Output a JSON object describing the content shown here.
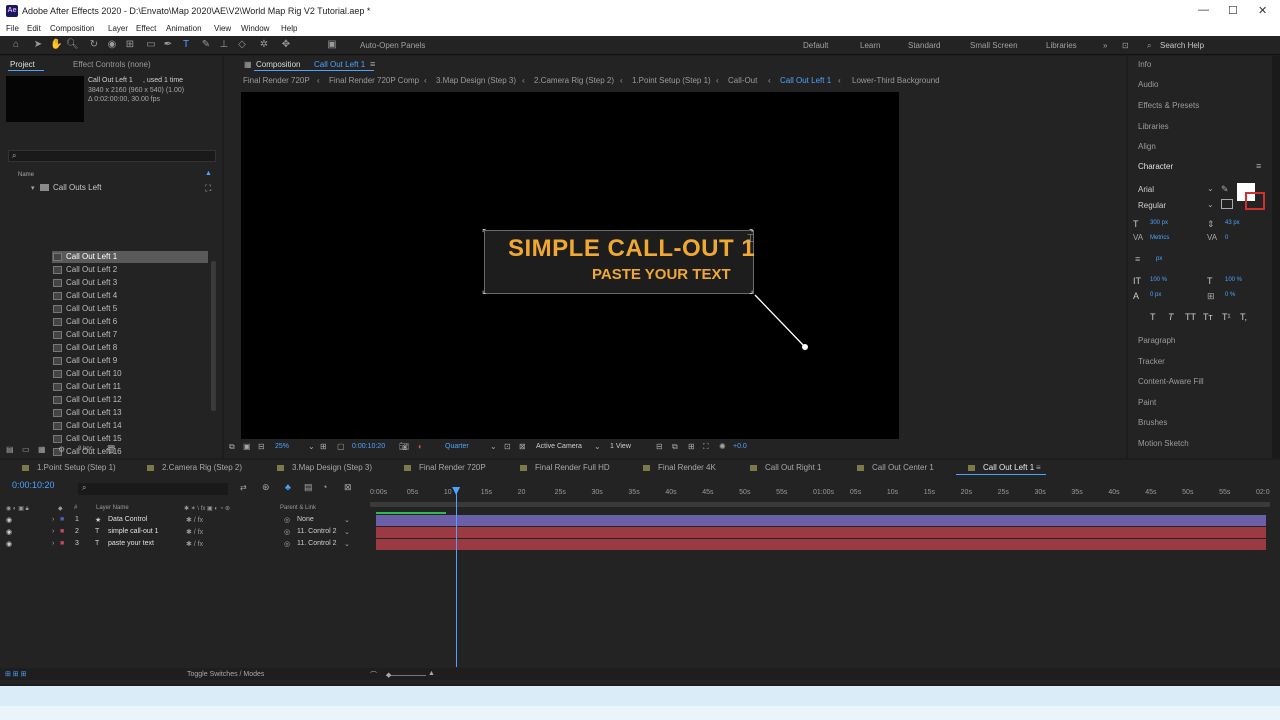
{
  "window": {
    "title": "Adobe After Effects 2020 - D:\\Envato\\Map 2020\\AE\\V2\\World Map Rig V2 Tutorial.aep *",
    "icon": "ae-logo",
    "min": "—",
    "max": "☐",
    "close": "✕"
  },
  "menu": [
    "File",
    "Edit",
    "Composition",
    "Layer",
    "Effect",
    "Animation",
    "View",
    "Window",
    "Help"
  ],
  "toolbar": {
    "auto_open": "Auto-Open Panels",
    "workspaces": [
      "Default",
      "Learn",
      "Standard",
      "Small Screen",
      "Libraries"
    ],
    "search": "Search Help"
  },
  "project": {
    "tab": "Project",
    "effect_controls": "Effect Controls (none)",
    "selected_name": "Call Out Left 1",
    "used": ", used 1 time",
    "dims": "3840 x 2160  (960 x 540) (1.00)",
    "duration": "Δ 0:02:00:00, 30.00 fps",
    "col_name": "Name",
    "folder": "Call Outs Left",
    "items": [
      "Call Out Left 1",
      "Call Out Left 2",
      "Call Out Left 3",
      "Call Out Left 4",
      "Call Out Left 5",
      "Call Out Left 6",
      "Call Out Left 7",
      "Call Out Left 8",
      "Call Out Left 9",
      "Call Out Left 10",
      "Call Out Left 11",
      "Call Out Left 12",
      "Call Out Left 13",
      "Call Out Left 14",
      "Call Out Left 15",
      "Call Out Left 16",
      "Call Out Left 17",
      "Call Out Left 18",
      "Call Out Left 19"
    ],
    "bpc": "8 bpc"
  },
  "composition": {
    "tab_prefix": "Composition",
    "tab_name": "Call Out Left 1",
    "breadcrumbs": [
      "Final Render 720P",
      "Final Render 720P Comp",
      "3.Map Design (Step 3)",
      "2.Camera Rig (Step 2)",
      "1.Point Setup (Step 1)",
      "Call-Out",
      "Call Out Left 1",
      "Lower-Third Background"
    ],
    "callout_title": "SIMPLE CALL-OUT 1",
    "callout_sub": "PASTE YOUR TEXT",
    "zoom": "25%",
    "time": "0:00:10:20",
    "resolution": "Quarter",
    "camera": "Active Camera",
    "views": "1 View",
    "exposure": "+0.0"
  },
  "right_panel": {
    "items": [
      "Info",
      "Audio",
      "Effects & Presets",
      "Libraries",
      "Align"
    ],
    "character": "Character",
    "font": "Arial",
    "style": "Regular",
    "size": "300 px",
    "leading": "43 px",
    "tracking": "0",
    "kerning": "Metrics",
    "vscale": "100 %",
    "hscale": "100 %",
    "baseline": "0 px",
    "tsume": "0 %",
    "unit": "px",
    "styles": [
      "T",
      "T",
      "TT",
      "Tт",
      "T¹",
      "T,"
    ],
    "sections": [
      "Paragraph",
      "Tracker",
      "Content-Aware Fill",
      "Paint",
      "Brushes",
      "Motion Sketch"
    ]
  },
  "timeline": {
    "tabs": [
      "1.Point Setup (Step 1)",
      "2.Camera Rig (Step 2)",
      "3.Map Design (Step 3)",
      "Final Render 720P",
      "Final Render Full HD",
      "Final Render 4K",
      "Call Out Right 1",
      "Call Out Center 1",
      "Call Out Left 1"
    ],
    "timecode": "0:00:10:20",
    "ruler": [
      "0:00s",
      "05s",
      "10",
      "15s",
      "20",
      "25s",
      "30s",
      "35s",
      "40s",
      "45s",
      "50s",
      "55s",
      "01:00s",
      "05s",
      "10s",
      "15s",
      "20s",
      "25s",
      "30s",
      "35s",
      "40s",
      "45s",
      "50s",
      "55s",
      "02:0"
    ],
    "columns": {
      "num": "#",
      "layer_name": "Layer Name",
      "parent": "Parent & Link"
    },
    "layers": [
      {
        "num": "1",
        "name": "Data Control",
        "parent": "None",
        "color": "#4a5fb6",
        "bar": "#6b5fa8"
      },
      {
        "num": "2",
        "name": "simple call-out 1",
        "parent": "11. Control 2",
        "color": "#c24a5a",
        "bar": "#9b3a43"
      },
      {
        "num": "3",
        "name": "paste your text",
        "parent": "11. Control 2",
        "color": "#c24a5a",
        "bar": "#9b3a43"
      }
    ],
    "toggle": "Toggle Switches / Modes",
    "playhead_fraction": 0.09
  }
}
